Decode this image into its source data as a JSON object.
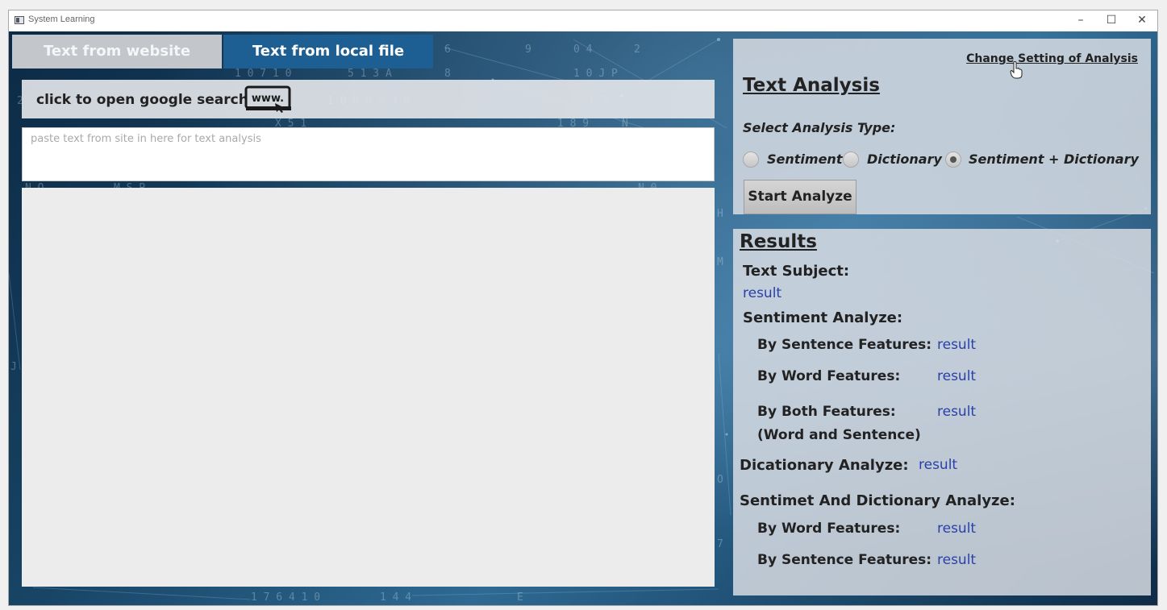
{
  "window": {
    "title": "System Learning",
    "minimize": "–",
    "maximize": "☐",
    "close": "✕"
  },
  "tabs": [
    {
      "label": "Text from website",
      "active": false
    },
    {
      "label": "Text from local file",
      "active": true
    }
  ],
  "search": {
    "label": "click to open google search",
    "icon_text": "www."
  },
  "paste_input": {
    "placeholder": "paste text from site in here for text analysis",
    "value": ""
  },
  "analysis": {
    "change_settings_link": "Change Setting of Analysis",
    "title": "Text Analysis",
    "select_label": "Select Analysis Type:",
    "options": [
      {
        "label": "Sentiment",
        "checked": false
      },
      {
        "label": "Dictionary",
        "checked": false
      },
      {
        "label": "Sentiment + Dictionary",
        "checked": true
      }
    ],
    "start_button": "Start Analyze"
  },
  "results": {
    "title": "Results",
    "text_subject_label": "Text Subject:",
    "text_subject_value": "result",
    "sentiment_label": "Sentiment Analyze:",
    "by_sentence_label": "By Sentence Features:",
    "by_sentence_value": "result",
    "by_word_label": "By Word Features:",
    "by_word_value": "result",
    "by_both_label": "By Both Features:",
    "by_both_sub": "(Word and Sentence)",
    "by_both_value": "result",
    "dictionary_label": "Dicationary Analyze:",
    "dictionary_value": "result",
    "sd_label": "Sentimet And Dictionary Analyze:",
    "sd_by_word_label": "By Word Features:",
    "sd_by_word_value": "result",
    "sd_by_sentence_label": "By Sentence Features:",
    "sd_by_sentence_value": "result"
  },
  "colors": {
    "active_tab": "#1e5f93",
    "inactive_tab": "#c3c6cb",
    "result_text": "#2a3fa8"
  }
}
